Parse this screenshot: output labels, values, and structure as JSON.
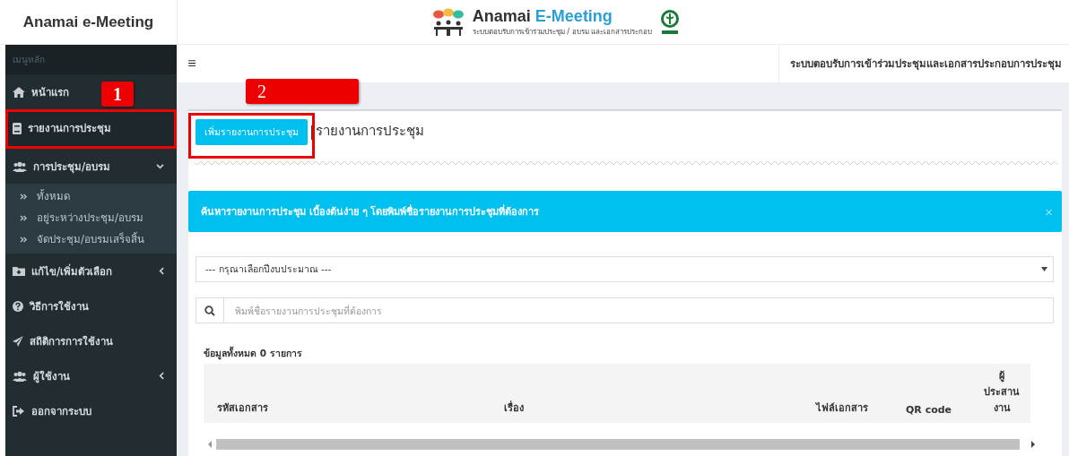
{
  "brand": {
    "title": "Anamai e-Meeting",
    "logo_name": "Anamai",
    "logo_accent": "E-Meeting",
    "logo_tagline": "ระบบตอบรับการเข้าร่วมประชุม / อบรม และเอกสารประกอบ"
  },
  "topbar": {
    "menu_toggle": "≡",
    "system_title": "ระบบตอบรับการเข้าร่วมประชุมและเอกสารประกอบการประชุม"
  },
  "sidebar": {
    "header": "เมนูหลัก",
    "items": [
      {
        "label": "หน้าแรก",
        "selected": false
      },
      {
        "label": "รายงานการประชุม",
        "selected": true,
        "marked": true
      },
      {
        "label": "การประชุม/อบรม",
        "selected": false,
        "expanded": true,
        "children": [
          {
            "label": "ทั้งหมด"
          },
          {
            "label": "อยู่ระหว่างประชุม/อบรม"
          },
          {
            "label": "จัดประชุม/อบรมเสร็จสิ้น"
          }
        ]
      },
      {
        "label": "แก้ไข/เพิ่มตัวเลือก",
        "selected": false,
        "expanded": false
      },
      {
        "label": "วิธีการใช้งาน",
        "selected": false
      },
      {
        "label": "สถิติการการใช้งาน",
        "selected": false
      },
      {
        "label": "ผู้ใช้งาน",
        "selected": false,
        "expanded": false
      },
      {
        "label": "ออกจากระบบ",
        "selected": false
      }
    ]
  },
  "annotations": [
    {
      "label": "1"
    },
    {
      "label": "2"
    }
  ],
  "page": {
    "add_button": {
      "label": "เพิ่มรายงานการประชุม",
      "marked": true
    },
    "title_separator": "|",
    "title": "รายงานการประชุม",
    "info_box": {
      "text": "ค้นหารายงานการประชุม เบื้องต้นง่าย ๆ โดยพิมพ์ชื่อรายงานการประชุมที่ต้องการ",
      "close": "×"
    },
    "year_select": {
      "value": "--- กรุณาเลือกปีงบประมาณ ---"
    },
    "search": {
      "placeholder": "พิมพ์ชื่อรายงานการประชุมที่ต้องการ"
    },
    "count": "ข้อมูลทั้งหมด 0 รายการ",
    "table": {
      "columns": [
        "รหัสเอกสาร",
        "เรื่อง",
        "ไฟล์เอกสาร",
        "QR code",
        "ผู้ประสานงาน"
      ]
    }
  }
}
